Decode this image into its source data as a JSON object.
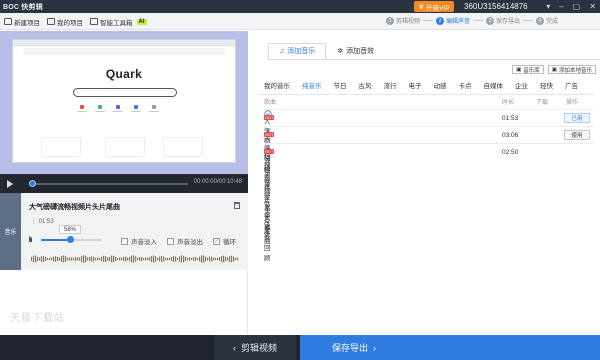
{
  "titlebar": {
    "logo": "BOC 快剪辑",
    "upgrade": "升级VIP",
    "account": "360U3156414876",
    "win_buttons": [
      "▾",
      "–",
      "▢",
      "✕"
    ]
  },
  "toolbar": {
    "items": [
      {
        "label": "新建项目"
      },
      {
        "label": "我的项目"
      },
      {
        "label": "智能工具箱",
        "badge": "AI"
      }
    ],
    "steps": [
      {
        "num": "1",
        "label": "剪辑视频",
        "active": false
      },
      {
        "num": "2",
        "label": "编辑声音",
        "active": true
      },
      {
        "num": "3",
        "label": "保存导出",
        "active": false
      },
      {
        "num": "4",
        "label": "完成",
        "active": false
      }
    ]
  },
  "preview": {
    "browser_logo": "Quark"
  },
  "player": {
    "timecode": "00:00:00/00:10:48"
  },
  "track": {
    "side_label": "音乐",
    "title": "大气磅礴流畅视频片头片尾曲",
    "duration": "01:53",
    "volume": "58%",
    "volume_fraction": 0.58,
    "options": [
      {
        "label": "声音淡入",
        "checked": false
      },
      {
        "label": "声音淡出",
        "checked": false
      },
      {
        "label": "循环",
        "checked": true
      }
    ]
  },
  "watermark": "天极下载站",
  "music": {
    "tabs": [
      {
        "label": "添加音乐",
        "icon": "music-note-icon",
        "active": true
      },
      {
        "label": "添加音效",
        "icon": "sound-effect-icon",
        "active": false
      }
    ],
    "library_buttons": [
      "音乐库",
      "添加本地音乐"
    ],
    "categories": [
      "我的音乐",
      "纯音乐",
      "节日",
      "古风",
      "流行",
      "电子",
      "动感",
      "卡点",
      "自媒体",
      "企业",
      "轻快",
      "广告"
    ],
    "active_category": 1,
    "columns": {
      "name": "歌曲",
      "duration": "时长",
      "download": "下载",
      "action": "操作"
    },
    "songs": [
      {
        "name": "大气磅礴流畅视频片头片尾曲",
        "hot": "HOT",
        "duration": "01:53",
        "action": "已用"
      },
      {
        "name": "大气磅礴宏伟军事大事件回顾",
        "hot": "HOT",
        "duration": "03:06",
        "action": "使用"
      },
      {
        "name": "科技未来感节奏走秀",
        "hot": "HOT",
        "duration": "02:50",
        "action": "使用"
      }
    ]
  },
  "bottom": {
    "edit_label": "剪辑视频",
    "export_label": "保存导出"
  }
}
